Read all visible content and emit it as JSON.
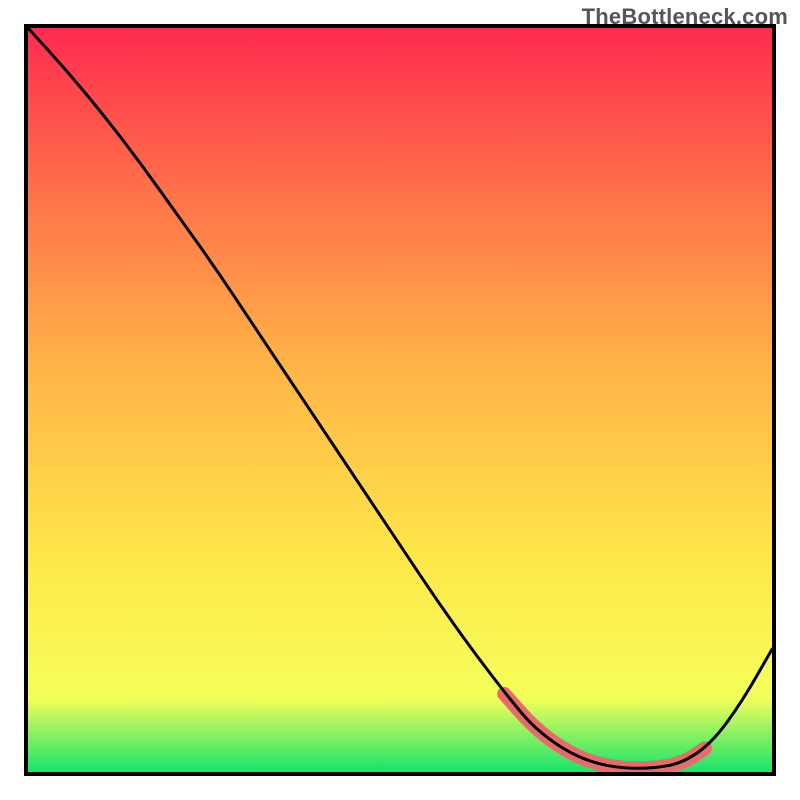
{
  "watermark": "TheBottleneck.com",
  "colors": {
    "grad_top": "#ff2b4f",
    "grad_mid1": "#ff6b4a",
    "grad_mid2": "#ffb347",
    "grad_mid3": "#ffe84a",
    "grad_mid4": "#f4ff5a",
    "grad_bot": "#17e36c",
    "curve": "#000000",
    "highlight": "#ea6a6c"
  },
  "chart_data": {
    "type": "line",
    "title": "",
    "xlabel": "",
    "ylabel": "",
    "xlim": [
      0,
      100
    ],
    "ylim": [
      0,
      100
    ],
    "series": [
      {
        "name": "bottleneck-curve",
        "x": [
          0,
          5,
          10,
          15,
          20,
          25,
          30,
          35,
          40,
          45,
          50,
          55,
          60,
          65,
          68,
          72,
          76,
          80,
          84,
          88,
          92,
          96,
          100
        ],
        "y": [
          100,
          94.5,
          88.5,
          82,
          75,
          68,
          60.5,
          53,
          45.5,
          38,
          30.5,
          23,
          16,
          9.5,
          6,
          3,
          1.2,
          0.5,
          0.5,
          1.2,
          4,
          9.5,
          16.5
        ]
      },
      {
        "name": "highlight-segment",
        "x": [
          64,
          68,
          72,
          76,
          80,
          84,
          88,
          91
        ],
        "y": [
          10.5,
          6,
          3,
          1.2,
          0.5,
          0.5,
          1.2,
          3.2
        ]
      }
    ]
  }
}
